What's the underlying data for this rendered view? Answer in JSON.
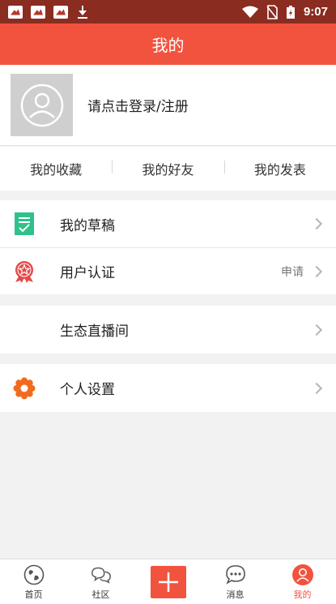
{
  "status_bar": {
    "time": "9:07",
    "icons": [
      "notification-icon",
      "notification-icon",
      "notification-icon",
      "download-icon",
      "wifi-icon",
      "no-sim-icon",
      "battery-charging-icon"
    ]
  },
  "header": {
    "title": "我的"
  },
  "profile": {
    "login_text": "请点击登录/注册",
    "avatar_icon": "user-avatar-icon"
  },
  "tabs": [
    {
      "label": "我的收藏"
    },
    {
      "label": "我的好友"
    },
    {
      "label": "我的发表"
    }
  ],
  "menu": {
    "drafts": {
      "label": "我的草稿",
      "icon": "draft-icon"
    },
    "verify": {
      "label": "用户认证",
      "extra": "申请",
      "icon": "badge-icon"
    },
    "live": {
      "label": "生态直播间"
    },
    "settings": {
      "label": "个人设置",
      "icon": "gear-icon"
    }
  },
  "bottom_nav": [
    {
      "label": "首页",
      "icon": "globe-icon"
    },
    {
      "label": "社区",
      "icon": "chat-bubbles-icon"
    },
    {
      "label": "",
      "icon": "plus-icon"
    },
    {
      "label": "消息",
      "icon": "message-icon"
    },
    {
      "label": "我的",
      "icon": "profile-icon",
      "active": true
    }
  ],
  "colors": {
    "accent": "#f2533f",
    "statusbar": "#8a2c20",
    "green": "#2ec28a",
    "orange": "#f26b1d"
  }
}
